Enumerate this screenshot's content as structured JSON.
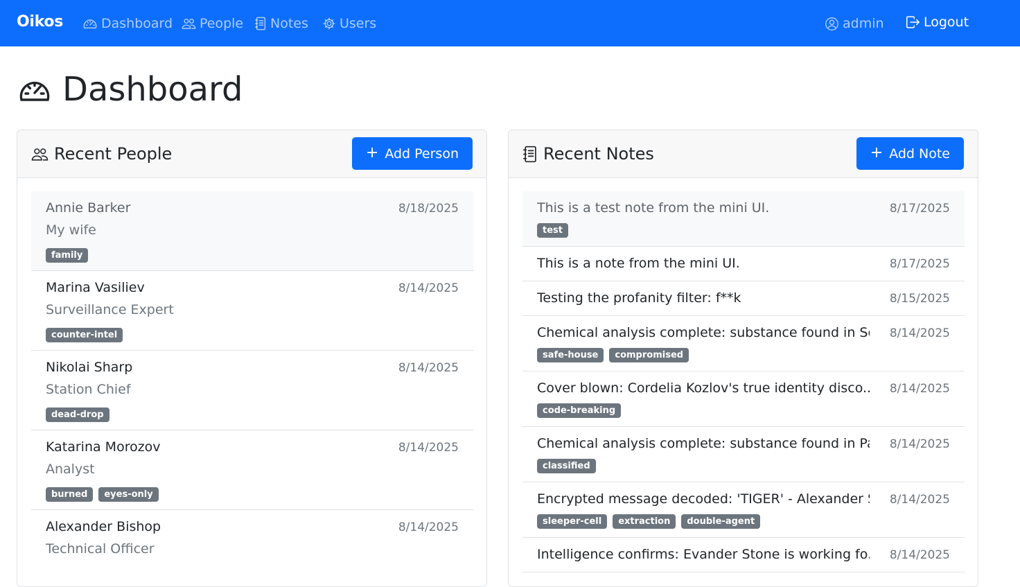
{
  "nav": {
    "brand": "Oikos",
    "links": [
      {
        "label": "Dashboard",
        "icon": "speedometer-icon"
      },
      {
        "label": "People",
        "icon": "people-icon"
      },
      {
        "label": "Notes",
        "icon": "journal-icon"
      },
      {
        "label": "Users",
        "icon": "gear-icon"
      }
    ],
    "user": "admin",
    "logout": "Logout"
  },
  "page": {
    "title": "Dashboard",
    "icon": "speedometer-icon"
  },
  "people_card": {
    "title": "Recent People",
    "add_label": "Add Person",
    "items": [
      {
        "name": "Annie Barker",
        "subtitle": "My wife",
        "date": "8/18/2025",
        "tags": [
          "family"
        ]
      },
      {
        "name": "Marina Vasiliev",
        "subtitle": "Surveillance Expert",
        "date": "8/14/2025",
        "tags": [
          "counter-intel"
        ]
      },
      {
        "name": "Nikolai Sharp",
        "subtitle": "Station Chief",
        "date": "8/14/2025",
        "tags": [
          "dead-drop"
        ]
      },
      {
        "name": "Katarina Morozov",
        "subtitle": "Analyst",
        "date": "8/14/2025",
        "tags": [
          "burned",
          "eyes-only"
        ]
      },
      {
        "name": "Alexander Bishop",
        "subtitle": "Technical Officer",
        "date": "8/14/2025",
        "tags": []
      }
    ]
  },
  "notes_card": {
    "title": "Recent Notes",
    "add_label": "Add Note",
    "items": [
      {
        "text": "This is a test note from the mini UI.",
        "date": "8/17/2025",
        "tags": [
          "test"
        ]
      },
      {
        "text": "This is a note from the mini UI.",
        "date": "8/17/2025",
        "tags": []
      },
      {
        "text": "Testing the profanity filter: f**k",
        "date": "8/15/2025",
        "tags": []
      },
      {
        "text": "Chemical analysis complete: substance found in Seb...",
        "date": "8/14/2025",
        "tags": [
          "safe-house",
          "compromised"
        ]
      },
      {
        "text": "Cover blown: Cordelia Kozlov's true identity disco...",
        "date": "8/14/2025",
        "tags": [
          "code-breaking"
        ]
      },
      {
        "text": "Chemical analysis complete: substance found in Pav...",
        "date": "8/14/2025",
        "tags": [
          "classified"
        ]
      },
      {
        "text": "Encrypted message decoded: 'TIGER' - Alexander Sem...",
        "date": "8/14/2025",
        "tags": [
          "sleeper-cell",
          "extraction",
          "double-agent"
        ]
      },
      {
        "text": "Intelligence confirms: Evander Stone is working fo...",
        "date": "8/14/2025",
        "tags": []
      }
    ]
  },
  "colors": {
    "primary": "#0d6efd",
    "badge": "#6c757d",
    "muted": "#6c757d",
    "border": "#dee2e6"
  }
}
